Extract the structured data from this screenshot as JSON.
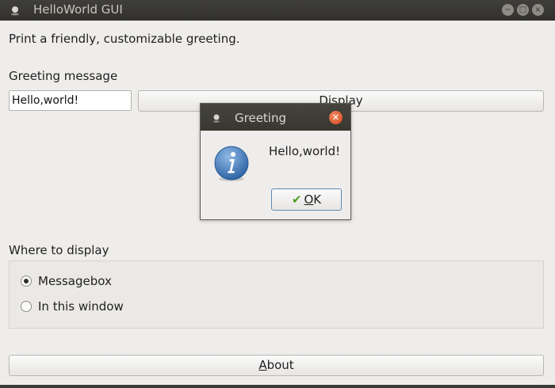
{
  "window": {
    "title": "HelloWorld GUI",
    "controls": {
      "minimize": "−",
      "maximize": "□",
      "close": "×"
    }
  },
  "main": {
    "description": "Print a friendly, customizable greeting.",
    "greeting_label": "Greeting message",
    "greeting_value": "Hello,world!",
    "display_button": "Display",
    "where_label": "Where to display",
    "options": [
      {
        "label": "Messagebox",
        "checked": true
      },
      {
        "label": "In this window",
        "checked": false
      }
    ],
    "about_button": {
      "mnemonic": "A",
      "rest": "bout"
    }
  },
  "dialog": {
    "title": "Greeting",
    "message": "Hello,world!",
    "ok_button": {
      "mnemonic": "O",
      "rest": "K"
    },
    "icon": "info-icon"
  },
  "colors": {
    "titlebar": "#3a3935",
    "close_button": "#e05a2b",
    "info_icon": "#3a73b0",
    "check": "#4f9a1e"
  }
}
